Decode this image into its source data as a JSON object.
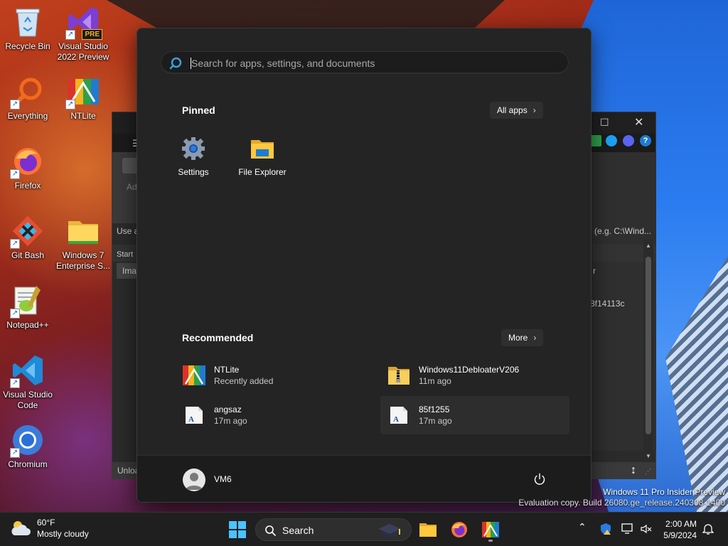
{
  "desktop": {
    "icons": [
      {
        "label": "Recycle Bin"
      },
      {
        "label": "Visual Studio 2022 Preview",
        "badge": "PRE"
      },
      {
        "label": "Everything"
      },
      {
        "label": "NTLite"
      },
      {
        "label": "Firefox"
      },
      {
        "label": "Git Bash"
      },
      {
        "label": "Windows 7 Enterprise S..."
      },
      {
        "label": "Notepad++"
      },
      {
        "label": "Visual Studio Code"
      },
      {
        "label": "Chromium"
      }
    ]
  },
  "background_window": {
    "fragments": {
      "add": "Ad",
      "use_a": "Use a",
      "start": "Start",
      "ima": "Ima",
      "path_hint": "(e.g. C:\\Wind...",
      "r": "r",
      "hash": "8f14113c",
      "unlo": "Unloa"
    }
  },
  "start_menu": {
    "search_placeholder": "Search for apps, settings, and documents",
    "pinned_title": "Pinned",
    "all_apps_label": "All apps",
    "pinned_apps": [
      {
        "label": "Settings",
        "icon": "gear-icon"
      },
      {
        "label": "File Explorer",
        "icon": "folder-icon"
      }
    ],
    "recommended_title": "Recommended",
    "more_label": "More",
    "recommended": [
      {
        "name": "NTLite",
        "sub": "Recently added",
        "icon": "ntlite-icon"
      },
      {
        "name": "Windows11DebloaterV206",
        "sub": "11m ago",
        "icon": "zip-folder-icon"
      },
      {
        "name": "angsaz",
        "sub": "17m ago",
        "icon": "document-icon"
      },
      {
        "name": "85f1255",
        "sub": "17m ago",
        "icon": "document-icon"
      }
    ],
    "user_name": "VM6"
  },
  "watermark": {
    "line1": "Windows 11 Pro Insider Preview",
    "line2": "Evaluation copy. Build 26080.ge_release.240308-1400"
  },
  "taskbar": {
    "weather_temp": "60°F",
    "weather_desc": "Mostly cloudy",
    "search_label": "Search",
    "time": "2:00 AM",
    "date": "5/9/2024"
  },
  "colors": {
    "accent": "#0078d4",
    "start_bg": "#242424",
    "taskbar_bg": "#1f1f1f"
  }
}
